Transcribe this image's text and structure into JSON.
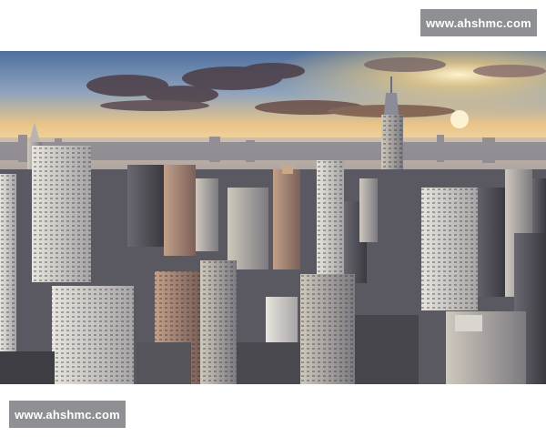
{
  "watermark": {
    "top_text": "www.ahshmc.com",
    "bottom_text": "www.ahshmc.com"
  },
  "photo": {
    "subject": "skyline-photo",
    "colors": {
      "sky_top": "#5a7aa6",
      "sky_glow": "#f5c46a",
      "sun": "#fff2c0",
      "clouds": "#4a3a40",
      "city_far": "#8b8a92",
      "city_near": "#3a3940"
    }
  }
}
